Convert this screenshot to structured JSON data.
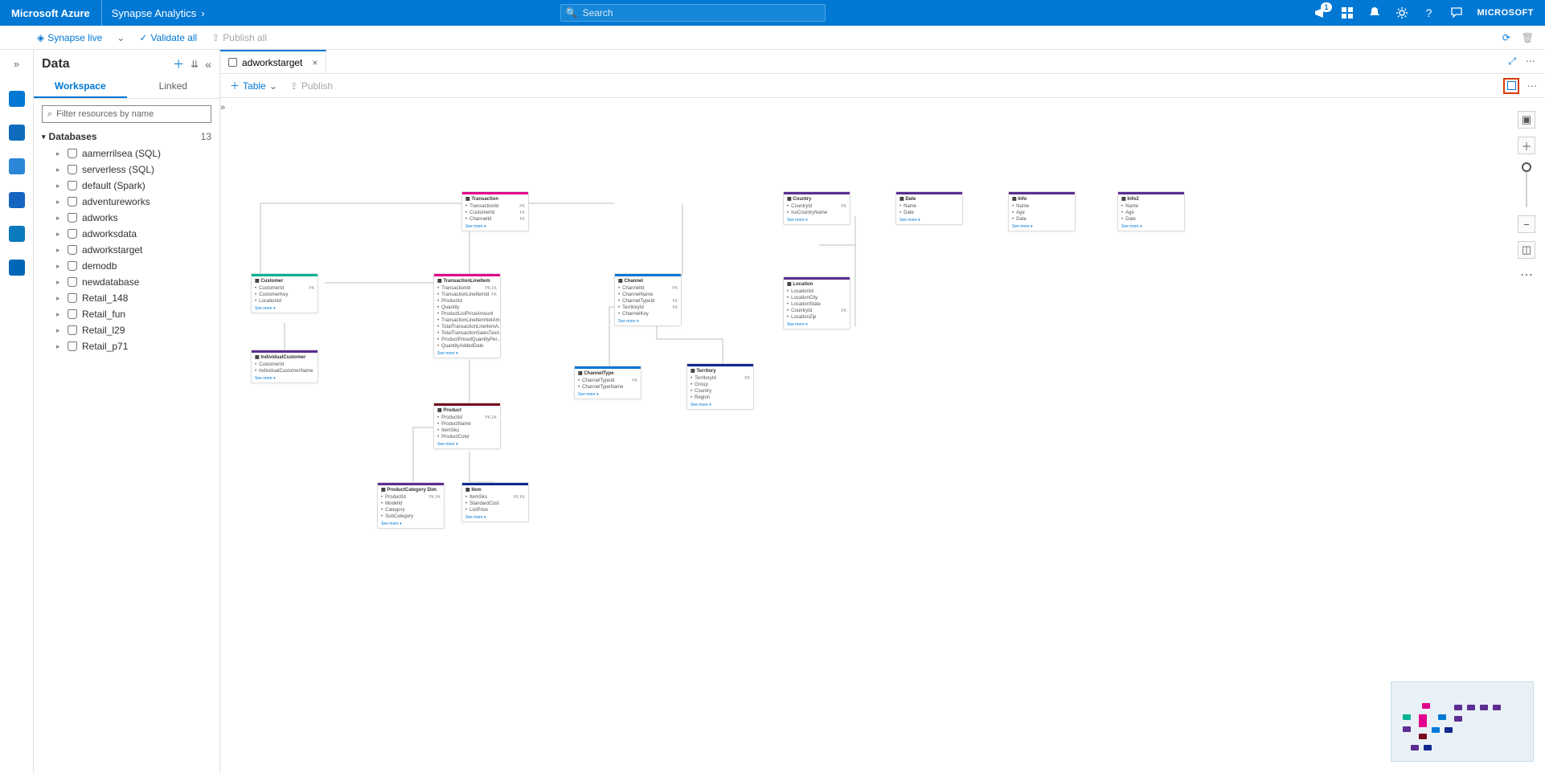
{
  "azure": {
    "brand": "Microsoft Azure",
    "product": "Synapse Analytics",
    "search_placeholder": "Search",
    "notif_count": "1",
    "account": "MICROSOFT"
  },
  "cmdbar": {
    "mode": "Synapse live",
    "validate": "Validate all",
    "publish": "Publish all"
  },
  "explorer": {
    "title": "Data",
    "tab_workspace": "Workspace",
    "tab_linked": "Linked",
    "filter_placeholder": "Filter resources by name",
    "section": "Databases",
    "count": "13",
    "items": [
      "aamerrilsea (SQL)",
      "serverless (SQL)",
      "default (Spark)",
      "adventureworks",
      "adworks",
      "adworksdata",
      "adworkstarget",
      "demodb",
      "newdatabase",
      "Retail_148",
      "Retail_fun",
      "Retail_l29",
      "Retail_p71"
    ]
  },
  "tab": {
    "name": "adworkstarget"
  },
  "subbar": {
    "table": "Table",
    "publish": "Publish"
  },
  "see_more": "See more",
  "entities": {
    "transaction": {
      "title": "Transaction",
      "cols": [
        {
          "n": "TransactionId",
          "k": "PK"
        },
        {
          "n": "CustomerId",
          "k": "FK"
        },
        {
          "n": "ChannelId",
          "k": "FK"
        }
      ]
    },
    "customer": {
      "title": "Customer",
      "cols": [
        {
          "n": "CustomerId",
          "k": "PK"
        },
        {
          "n": "CustomerKey",
          "k": ""
        },
        {
          "n": "LocationId",
          "k": ""
        }
      ]
    },
    "indcust": {
      "title": "IndividualCustomer",
      "cols": [
        {
          "n": "CustomerId",
          "k": ""
        },
        {
          "n": "IndividualCustomerName",
          "k": ""
        }
      ]
    },
    "txli": {
      "title": "TransactionLineItem",
      "cols": [
        {
          "n": "TransactionId",
          "k": "PK,FK"
        },
        {
          "n": "TransactionLineItemId",
          "k": "PK"
        },
        {
          "n": "ProductId",
          "k": ""
        },
        {
          "n": "Quantity",
          "k": ""
        },
        {
          "n": "ProductListPriceAmount",
          "k": ""
        },
        {
          "n": "TransactionLineItemNetAmo...",
          "k": ""
        },
        {
          "n": "TotalTransactionLineItemA...",
          "k": ""
        },
        {
          "n": "TotalTransactionSalesTaxA...",
          "k": ""
        },
        {
          "n": "ProductPricedQuantityPer...",
          "k": ""
        },
        {
          "n": "QuantityAddedDate",
          "k": ""
        }
      ]
    },
    "product": {
      "title": "Product",
      "cols": [
        {
          "n": "ProductId",
          "k": "PK,FK"
        },
        {
          "n": "ProductName",
          "k": ""
        },
        {
          "n": "ItemSku",
          "k": ""
        },
        {
          "n": "ProductColor",
          "k": ""
        }
      ]
    },
    "pcd": {
      "title": "ProductCategory Dim",
      "cols": [
        {
          "n": "ProductId",
          "k": "PK,FK"
        },
        {
          "n": "ModelId",
          "k": ""
        },
        {
          "n": "Category",
          "k": ""
        },
        {
          "n": "SubCategory",
          "k": ""
        }
      ]
    },
    "item": {
      "title": "Item",
      "cols": [
        {
          "n": "ItemSku",
          "k": "PK,FK"
        },
        {
          "n": "StandardCost",
          "k": ""
        },
        {
          "n": "ListPrice",
          "k": ""
        }
      ]
    },
    "channel": {
      "title": "Channel",
      "cols": [
        {
          "n": "ChannelId",
          "k": "PK"
        },
        {
          "n": "ChannelName",
          "k": ""
        },
        {
          "n": "ChannelTypeId",
          "k": "FK"
        },
        {
          "n": "TerritoryId",
          "k": "FK"
        },
        {
          "n": "ChannelKey",
          "k": ""
        }
      ]
    },
    "chtype": {
      "title": "ChannelType",
      "cols": [
        {
          "n": "ChannelTypeId",
          "k": "PK"
        },
        {
          "n": "ChannelTypeName",
          "k": ""
        }
      ]
    },
    "terr": {
      "title": "Territory",
      "cols": [
        {
          "n": "TerritoryId",
          "k": "PK"
        },
        {
          "n": "Group",
          "k": ""
        },
        {
          "n": "Country",
          "k": ""
        },
        {
          "n": "Region",
          "k": ""
        }
      ]
    },
    "country": {
      "title": "Country",
      "cols": [
        {
          "n": "CountryId",
          "k": "PK"
        },
        {
          "n": "IsoCountryName",
          "k": ""
        }
      ]
    },
    "location": {
      "title": "Location",
      "cols": [
        {
          "n": "LocationId",
          "k": ""
        },
        {
          "n": "LocationCity",
          "k": ""
        },
        {
          "n": "LocationState",
          "k": ""
        },
        {
          "n": "CountryId",
          "k": "FK"
        },
        {
          "n": "LocationZip",
          "k": ""
        }
      ]
    },
    "date": {
      "title": "Date",
      "cols": [
        {
          "n": "Name",
          "k": ""
        },
        {
          "n": "Date",
          "k": ""
        }
      ]
    },
    "info": {
      "title": "Info",
      "cols": [
        {
          "n": "Name",
          "k": ""
        },
        {
          "n": "Age",
          "k": ""
        },
        {
          "n": "Date",
          "k": ""
        }
      ]
    },
    "info2": {
      "title": "Info2",
      "cols": [
        {
          "n": "Name",
          "k": ""
        },
        {
          "n": "Age",
          "k": ""
        },
        {
          "n": "Date",
          "k": ""
        }
      ]
    }
  }
}
